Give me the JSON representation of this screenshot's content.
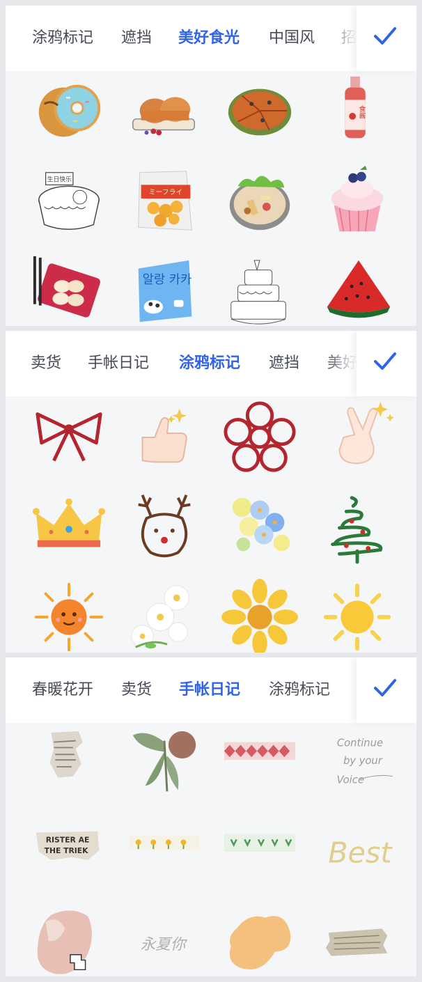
{
  "panels": [
    {
      "tabs": [
        "涂鸦标记",
        "遮挡",
        "美好食光",
        "中国风",
        "招"
      ],
      "active_tab": "美好食光",
      "accent": "#2f63e8",
      "stickers": [
        [
          "donut-icon",
          "toast-board-icon",
          "pizza-icon",
          "sauce-bottle-icon"
        ],
        [
          "birthday-cake-sketch-icon",
          "snack-bag-icon",
          "hotpot-bowl-icon",
          "cupcake-icon"
        ],
        [
          "dumpling-plate-icon",
          "milk-candy-bag-icon",
          "layer-cake-sketch-icon",
          "watermelon-slice-icon"
        ]
      ],
      "texts": {
        "birthday": "生日快乐",
        "sauce": "食酱",
        "snack": "ミーフライ",
        "candy": "알랑 카카"
      }
    },
    {
      "tabs": [
        "卖货",
        "手帐日记",
        "涂鸦标记",
        "遮挡",
        "美好"
      ],
      "active_tab": "涂鸦标记",
      "accent": "#2f63e8",
      "stickers": [
        [
          "bow-doodle-icon",
          "thumbs-up-icon",
          "flower-doodle-icon",
          "victory-hand-icon"
        ],
        [
          "crown-icon",
          "reindeer-doodle-icon",
          "flower-bouquet-icon",
          "christmas-tree-doodle-icon"
        ],
        [
          "smiling-sun-icon",
          "daisy-cluster-icon",
          "sunflower-icon",
          "bright-sun-icon"
        ]
      ]
    },
    {
      "tabs": [
        "春暖花开",
        "卖货",
        "手帐日记",
        "涂鸦标记"
      ],
      "active_tab": "手帐日记",
      "accent": "#2f63e8",
      "stickers": [
        [
          "newspaper-scrap-icon",
          "leaf-collage-icon",
          "washi-tape-diamond-icon",
          "handwriting-note-icon"
        ],
        [
          "newspaper-headline-scrap-icon",
          "flower-tape-icon",
          "grass-tape-icon",
          "best-script-icon"
        ],
        [
          "pink-paper-shape-icon",
          "calligraphy-text-icon",
          "orange-blob-icon",
          "paper-scrap-icon"
        ]
      ],
      "texts": {
        "note_1": "Continue",
        "note_2": "by your",
        "note_3": "Voice",
        "headline_1": "RISTER AE",
        "headline_2": "THE TRIEK",
        "best": "Best",
        "calligraphy": "永夏你"
      }
    }
  ]
}
